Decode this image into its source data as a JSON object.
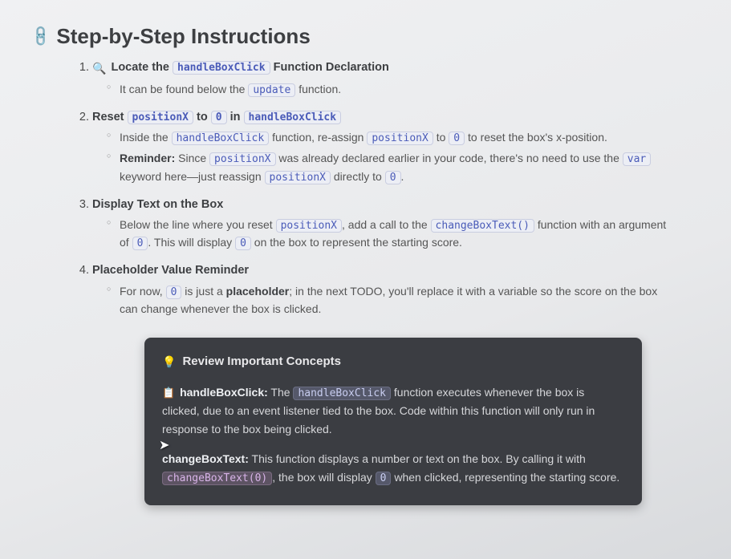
{
  "title": "Step-by-Step Instructions",
  "steps": {
    "s1": {
      "title_prefix": "Locate the ",
      "title_code": "handleBoxClick",
      "title_suffix": " Function Declaration",
      "sub1_a": "It can be found below the ",
      "sub1_code": "update",
      "sub1_b": " function."
    },
    "s2": {
      "title_a": "Reset ",
      "title_c1": "positionX",
      "title_b": " to ",
      "title_c2": "0",
      "title_c": " in ",
      "title_c3": "handleBoxClick",
      "sub1_a": "Inside the ",
      "sub1_c1": "handleBoxClick",
      "sub1_b": " function, re-assign ",
      "sub1_c2": "positionX",
      "sub1_c": " to ",
      "sub1_c3": "0",
      "sub1_d": " to reset the box's x-position.",
      "sub2_label": "Reminder:",
      "sub2_a": " Since ",
      "sub2_c1": "positionX",
      "sub2_b": " was already declared earlier in your code, there's no need to use the ",
      "sub2_c2": "var",
      "sub2_c": " keyword here—just reassign ",
      "sub2_c3": "positionX",
      "sub2_d": " directly to ",
      "sub2_c4": "0",
      "sub2_e": "."
    },
    "s3": {
      "title": "Display Text on the Box",
      "sub1_a": "Below the line where you reset ",
      "sub1_c1": "positionX",
      "sub1_b": ", add a call to the ",
      "sub1_c2": "changeBoxText()",
      "sub1_c": " function with an argument of ",
      "sub1_c3": "0",
      "sub1_d": ". This will display ",
      "sub1_c4": "0",
      "sub1_e": " on the box to represent the starting score."
    },
    "s4": {
      "title": "Placeholder Value Reminder",
      "sub1_a": "For now, ",
      "sub1_c1": "0",
      "sub1_b": " is just a ",
      "sub1_strong": "placeholder",
      "sub1_c": "; in the next TODO, you'll replace it with a variable so the score on the box can change whenever the box is clicked."
    }
  },
  "callout": {
    "header": "Review Important Concepts",
    "p1_label": "handleBoxClick:",
    "p1_a": " The ",
    "p1_c1": "handleBoxClick",
    "p1_b": " function executes whenever the box is clicked, due to an event listener tied to the box. Code within this function will only run in response to the box being clicked.",
    "p2_label": "changeBoxText:",
    "p2_a": " This function displays a number or text on the box. By calling it with ",
    "p2_c1": "changeBoxText(0)",
    "p2_b": ", the box will display ",
    "p2_c2": "0",
    "p2_c": " when clicked, representing the starting score."
  }
}
